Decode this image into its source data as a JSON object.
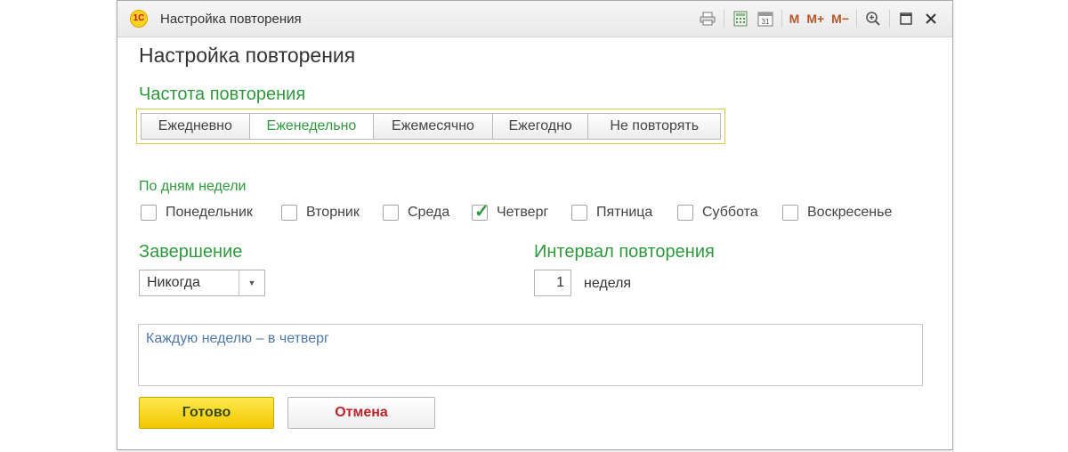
{
  "window": {
    "title": "Настройка повторения",
    "logo_text": "1С",
    "toolbar_icons": [
      "print-icon",
      "calculator-icon",
      "calendar-icon",
      "memory-m-icon",
      "memory-plus-icon",
      "memory-minus-icon",
      "zoom-icon",
      "maximize-icon",
      "close-icon"
    ],
    "toolbar_labels": {
      "calendar_day": "31",
      "m": "M",
      "m_plus": "M+",
      "m_minus": "M−"
    }
  },
  "page_title": "Настройка повторения",
  "frequency": {
    "label": "Частота повторения",
    "options": [
      "Ежедневно",
      "Еженедельно",
      "Ежемесячно",
      "Ежегодно",
      "Не повторять"
    ],
    "selected": "Еженедельно"
  },
  "weekdays": {
    "label": "По дням недели",
    "days": [
      {
        "label": "Понедельник",
        "checked": false
      },
      {
        "label": "Вторник",
        "checked": false
      },
      {
        "label": "Среда",
        "checked": false
      },
      {
        "label": "Четверг",
        "checked": true
      },
      {
        "label": "Пятница",
        "checked": false
      },
      {
        "label": "Суббота",
        "checked": false
      },
      {
        "label": "Воскресенье",
        "checked": false
      }
    ]
  },
  "completion": {
    "label": "Завершение",
    "value": "Никогда"
  },
  "interval": {
    "label": "Интервал повторения",
    "value": "1",
    "unit": "неделя"
  },
  "description": "Каждую неделю – в четверг",
  "buttons": {
    "ok": "Готово",
    "cancel": "Отмена"
  },
  "colors": {
    "accent_green": "#2f9a3d",
    "ok_yellow": "#f2c800",
    "cancel_red": "#b8242a",
    "description_blue": "#4e79a7"
  }
}
